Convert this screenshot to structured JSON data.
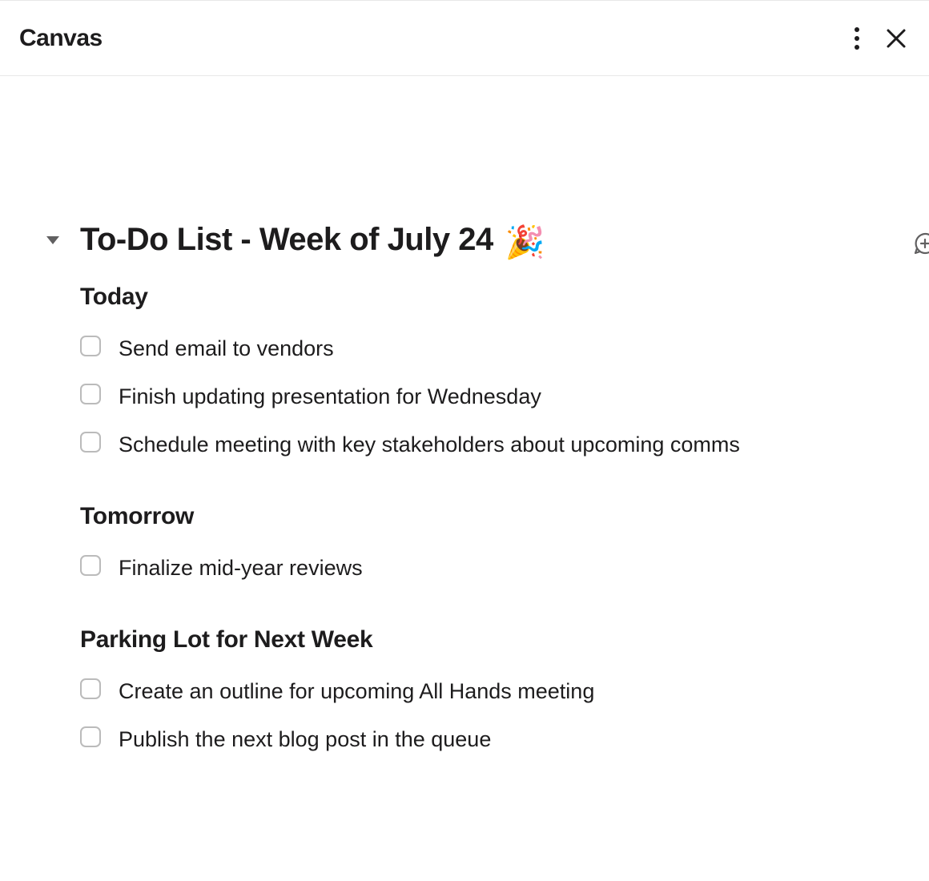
{
  "header": {
    "title": "Canvas"
  },
  "document": {
    "title": "To-Do List - Week of July 24",
    "emoji": "🎉",
    "sections": [
      {
        "heading": "Today",
        "items": [
          "Send email to vendors",
          "Finish updating presentation for Wednesday",
          "Schedule meeting with key stakeholders about upcoming comms"
        ]
      },
      {
        "heading": "Tomorrow",
        "items": [
          "Finalize mid-year reviews"
        ]
      },
      {
        "heading": "Parking Lot for Next Week",
        "items": [
          "Create an outline for upcoming All Hands meeting",
          "Publish the next blog post in the queue"
        ]
      }
    ]
  }
}
